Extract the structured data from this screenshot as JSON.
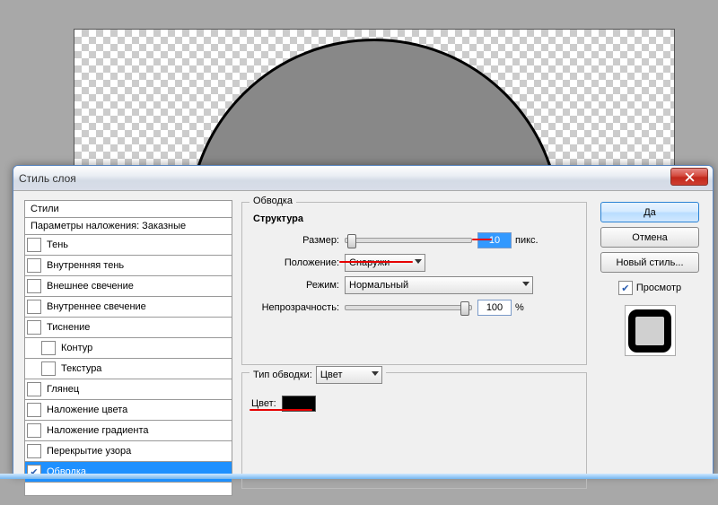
{
  "dialog": {
    "title": "Стиль слоя"
  },
  "sidebar": {
    "header": "Стили",
    "subheader": "Параметры наложения: Заказные",
    "items": [
      {
        "label": "Тень",
        "checked": false,
        "indent": false
      },
      {
        "label": "Внутренняя тень",
        "checked": false,
        "indent": false
      },
      {
        "label": "Внешнее свечение",
        "checked": false,
        "indent": false
      },
      {
        "label": "Внутреннее свечение",
        "checked": false,
        "indent": false
      },
      {
        "label": "Тиснение",
        "checked": false,
        "indent": false
      },
      {
        "label": "Контур",
        "checked": false,
        "indent": true
      },
      {
        "label": "Текстура",
        "checked": false,
        "indent": true
      },
      {
        "label": "Глянец",
        "checked": false,
        "indent": false
      },
      {
        "label": "Наложение цвета",
        "checked": false,
        "indent": false
      },
      {
        "label": "Наложение градиента",
        "checked": false,
        "indent": false
      },
      {
        "label": "Перекрытие узора",
        "checked": false,
        "indent": false
      },
      {
        "label": "Обводка",
        "checked": true,
        "indent": false,
        "selected": true
      }
    ]
  },
  "panel": {
    "title": "Обводка",
    "structure_label": "Структура",
    "size_label": "Размер:",
    "size_value": "10",
    "size_unit": "пикс.",
    "position_label": "Положение:",
    "position_value": "Снаружи",
    "mode_label": "Режим:",
    "mode_value": "Нормальный",
    "opacity_label": "Непрозрачность:",
    "opacity_value": "100",
    "opacity_unit": "%",
    "stroketype_label": "Тип обводки:",
    "stroketype_value": "Цвет",
    "color_label": "Цвет:",
    "color_value": "#000000"
  },
  "buttons": {
    "ok": "Да",
    "cancel": "Отмена",
    "new_style": "Новый стиль...",
    "preview": "Просмотр"
  }
}
